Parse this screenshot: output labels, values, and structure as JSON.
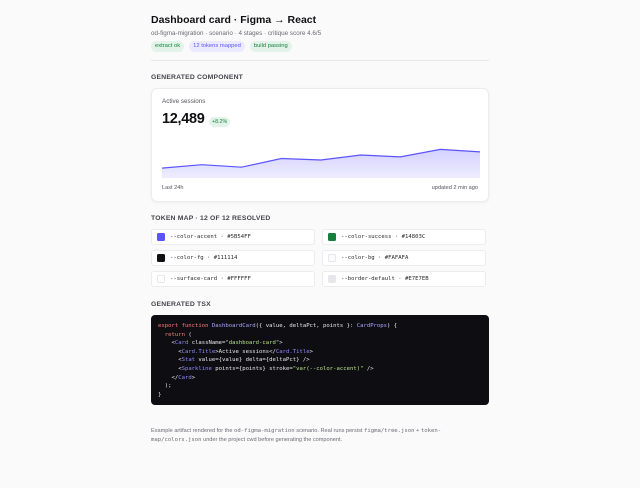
{
  "header": {
    "title": "Dashboard card · Figma → React",
    "subtitle": "od-figma-migration · scenario · 4 stages · critique score 4.6/5",
    "badges": [
      "extract ok",
      "12 tokens mapped",
      "build passing"
    ]
  },
  "sections": {
    "component": "GENERATED COMPONENT",
    "tokens": "TOKEN MAP · 12 OF 12 RESOLVED",
    "tsx": "GENERATED TSX"
  },
  "card": {
    "title": "Active sessions",
    "value": "12,489",
    "delta": "+8.2%",
    "footer_left": "Last 24h",
    "footer_right": "updated 2 min ago",
    "sparkline_relative": [
      0.22,
      0.33,
      0.25,
      0.53,
      0.48,
      0.64,
      0.58,
      0.82,
      0.74
    ],
    "colors": {
      "line": "#5B54FF",
      "fill": "#DAD8FF"
    }
  },
  "tokens": [
    {
      "label": "--color-accent · #5B54FF",
      "color": "#5B54FF"
    },
    {
      "label": "--color-success · #14803C",
      "color": "#14803C"
    },
    {
      "label": "--color-fg · #111114",
      "color": "#111114"
    },
    {
      "label": "--color-bg · #FAFAFA",
      "color": "#FAFAFA"
    },
    {
      "label": "--surface-card · #FFFFFF",
      "color": "#FFFFFF"
    },
    {
      "label": "--border-default · #E7E7EB",
      "color": "#E7E7EB"
    }
  ],
  "code": [
    [
      [
        "kw",
        "export function "
      ],
      [
        "fn",
        "DashboardCard"
      ],
      [
        "",
        "({ value, deltaPct, points }: "
      ],
      [
        "fn",
        "CardProps"
      ],
      [
        "",
        ") {"
      ]
    ],
    [
      [
        "",
        "  "
      ],
      [
        "kw",
        "return"
      ],
      [
        "",
        " ("
      ]
    ],
    [
      [
        "",
        "    <"
      ],
      [
        "tg",
        "Card"
      ],
      [
        "",
        " className="
      ],
      [
        "st",
        "\"dashboard-card\""
      ],
      [
        "",
        ">"
      ]
    ],
    [
      [
        "",
        "      <"
      ],
      [
        "tg",
        "Card.Title"
      ],
      [
        "",
        ">Active sessions</"
      ],
      [
        "tg",
        "Card.Title"
      ],
      [
        "",
        ">"
      ]
    ],
    [
      [
        "",
        "      <"
      ],
      [
        "tg",
        "Stat"
      ],
      [
        "",
        " value={value} delta={deltaPct} />"
      ]
    ],
    [
      [
        "",
        "      <"
      ],
      [
        "tg",
        "Sparkline"
      ],
      [
        "",
        " points={points} stroke="
      ],
      [
        "st",
        "\"var(--color-accent)\""
      ],
      [
        "",
        " />"
      ]
    ],
    [
      [
        "",
        "    </"
      ],
      [
        "tg",
        "Card"
      ],
      [
        "",
        ">"
      ]
    ],
    [
      [
        "",
        "  );"
      ]
    ],
    [
      [
        "",
        "}"
      ]
    ]
  ],
  "footer": {
    "text1": "Example artifact rendered for the ",
    "code1": "od-figma-migration",
    "text2": " scenario. Real runs persist ",
    "code2": "figma/tree.json",
    "text3": " + ",
    "code3": "token-map/colors.json",
    "text4": " under the project cwd before generating the component."
  }
}
